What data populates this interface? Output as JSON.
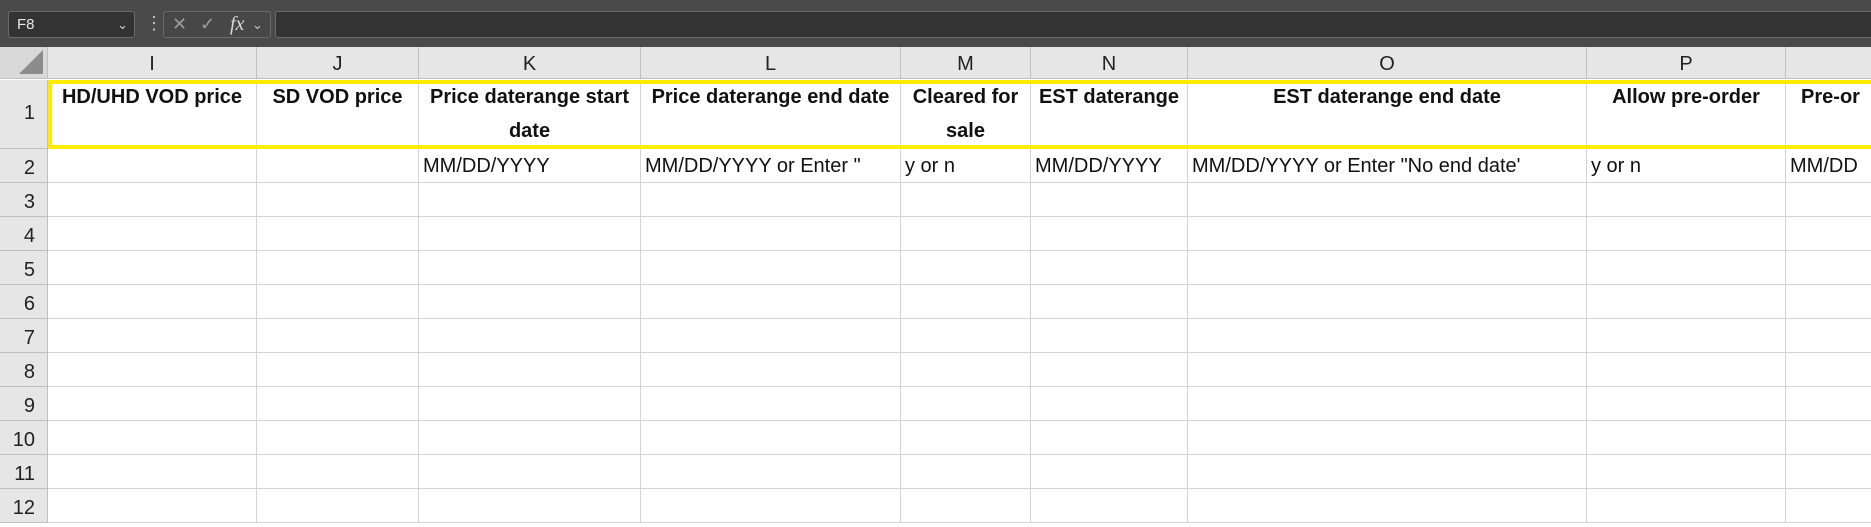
{
  "formula_bar": {
    "name_box": "F8",
    "fx_label": "fx",
    "formula": ""
  },
  "grid": {
    "columns": [
      "I",
      "J",
      "K",
      "L",
      "M",
      "N",
      "O",
      "P",
      ""
    ],
    "rows": [
      "1",
      "2",
      "3",
      "4",
      "5",
      "6",
      "7",
      "8",
      "9",
      "10",
      "11",
      "12"
    ],
    "header_row": [
      "HD/UHD VOD price",
      "SD VOD price",
      "Price daterange start date",
      "Price daterange end date",
      "Cleared for sale",
      "EST daterange",
      "EST daterange end date",
      "Allow pre-order",
      "Pre-or"
    ],
    "row2": [
      "",
      "",
      "MM/DD/YYYY",
      "MM/DD/YYYY or Enter \"",
      "y or n",
      "MM/DD/YYYY",
      "MM/DD/YYYY or Enter \"No end date'",
      "y or n",
      "MM/DD"
    ]
  },
  "colors": {
    "selection_border": "#ffec00",
    "toolbar_bg": "#4a4a4a",
    "header_bg": "#e6e6e6"
  }
}
